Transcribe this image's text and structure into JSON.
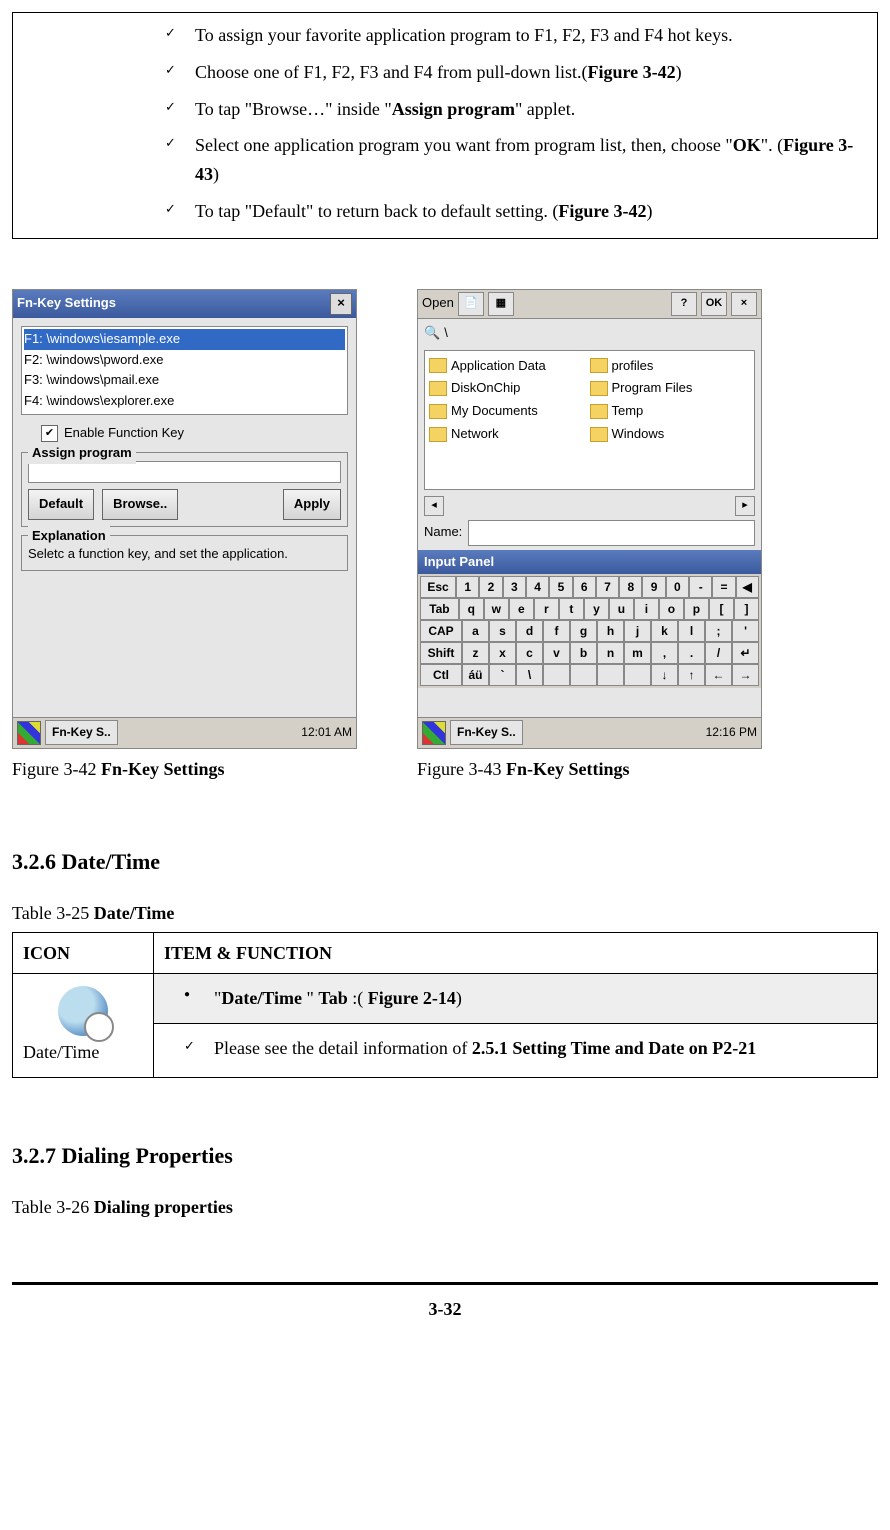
{
  "top_list": {
    "items": [
      "To assign your favorite application program to F1, F2, F3 and F4 hot keys.",
      "Choose one of F1, F2, F3 and F4 from pull-down list.(<b>Figure 3-42</b>)",
      "To tap \"Browse…\" inside \"<b>Assign program</b>\" applet.",
      "Select one application program you want from program list, then, choose \"<b>OK</b>\". (<b>Figure 3-43</b>)",
      "To tap \"Default\" to return back to default setting. (<b>Figure 3-42</b>)"
    ]
  },
  "fig342": {
    "title": "Fn-Key Settings",
    "list": [
      "F1:  \\windows\\iesample.exe",
      "F2:  \\windows\\pword.exe",
      "F3:  \\windows\\pmail.exe",
      "F4:  \\windows\\explorer.exe"
    ],
    "checkbox": "Enable Function Key",
    "group1": "Assign program",
    "btn_default": "Default",
    "btn_browse": "Browse..",
    "btn_apply": "Apply",
    "group2": "Explanation",
    "explanation": "Seletc a function key, and set the application.",
    "task": "Fn-Key S..",
    "time": "12:01 AM",
    "caption_prefix": "Figure 3-42 ",
    "caption_bold": "Fn-Key Settings"
  },
  "fig343": {
    "open": "Open",
    "help": "?",
    "ok": "OK",
    "close": "×",
    "path": "\\",
    "left_items": [
      "Application Data",
      "DiskOnChip",
      "My Documents",
      "Network"
    ],
    "right_items": [
      "profiles",
      "Program Files",
      "Temp",
      "Windows"
    ],
    "name_label": "Name:",
    "input_panel": "Input Panel",
    "kbd_rows": [
      [
        "Esc",
        "1",
        "2",
        "3",
        "4",
        "5",
        "6",
        "7",
        "8",
        "9",
        "0",
        "-",
        "=",
        "◀"
      ],
      [
        "Tab",
        "q",
        "w",
        "e",
        "r",
        "t",
        "y",
        "u",
        "i",
        "o",
        "p",
        "[",
        "]"
      ],
      [
        "CAP",
        "a",
        "s",
        "d",
        "f",
        "g",
        "h",
        "j",
        "k",
        "l",
        ";",
        "'"
      ],
      [
        "Shift",
        "z",
        "x",
        "c",
        "v",
        "b",
        "n",
        "m",
        ",",
        ".",
        "/",
        "↵"
      ],
      [
        "Ctl",
        "áü",
        "`",
        "\\",
        " ",
        " ",
        " ",
        " ",
        "↓",
        "↑",
        "←",
        "→"
      ]
    ],
    "task": "Fn-Key S..",
    "time": "12:16 PM",
    "caption_prefix": "Figure 3-43 ",
    "caption_bold": "Fn-Key Settings"
  },
  "section_326": "3.2.6 Date/Time",
  "table325_caption_prefix": "Table 3-25 ",
  "table325_caption_bold": "Date/Time",
  "table325": {
    "h1": "ICON",
    "h2": "ITEM & FUNCTION",
    "icon_label": "Date/Time",
    "tab_row": "\"<b>Date/Time </b>\" <b>Tab</b> :( <b>Figure 2-14</b>)",
    "detail_row": "Please see the detail information of <b>2.5.1 Setting Time and Date on P2-21</b>"
  },
  "section_327": "3.2.7 Dialing Properties",
  "table326_caption_prefix": "Table 3-26 ",
  "table326_caption_bold": "Dialing properties",
  "page_number": "3-32"
}
